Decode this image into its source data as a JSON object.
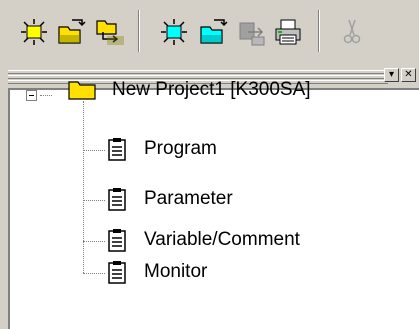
{
  "toolbar": {
    "buttons": [
      {
        "name": "new-project-icon",
        "icon": "sun-new-icon"
      },
      {
        "name": "open-project-icon",
        "icon": "folder-open-icon"
      },
      {
        "name": "save-project-icon",
        "icon": "folder-swap-icon"
      },
      {
        "name": "new-program-icon",
        "icon": "sun-new-cyan-icon"
      },
      {
        "name": "open-program-icon",
        "icon": "folder-open-cyan-icon"
      },
      {
        "name": "save-program-icon",
        "icon": "save-disabled-icon"
      },
      {
        "name": "print-icon",
        "icon": "printer-icon"
      },
      {
        "name": "cut-icon",
        "icon": "scissors-icon"
      }
    ]
  },
  "panel": {
    "minimize_glyph": "▾",
    "close_glyph": "✕"
  },
  "tree": {
    "root": {
      "label": "New Project1 [K300SA]",
      "icon": "folder-icon",
      "expanded": true
    },
    "children": [
      {
        "label": "Program",
        "icon": "clipboard-icon"
      },
      {
        "label": "Parameter",
        "icon": "clipboard-icon"
      },
      {
        "label": "Variable/Comment",
        "icon": "clipboard-icon"
      },
      {
        "label": "Monitor",
        "icon": "clipboard-icon"
      }
    ]
  },
  "colors": {
    "chrome": "#d4d0c8",
    "folder": "#ffe000",
    "sun": "#ffff00",
    "sun_cyan": "#00ffff",
    "tree_bg": "#ffffff"
  }
}
